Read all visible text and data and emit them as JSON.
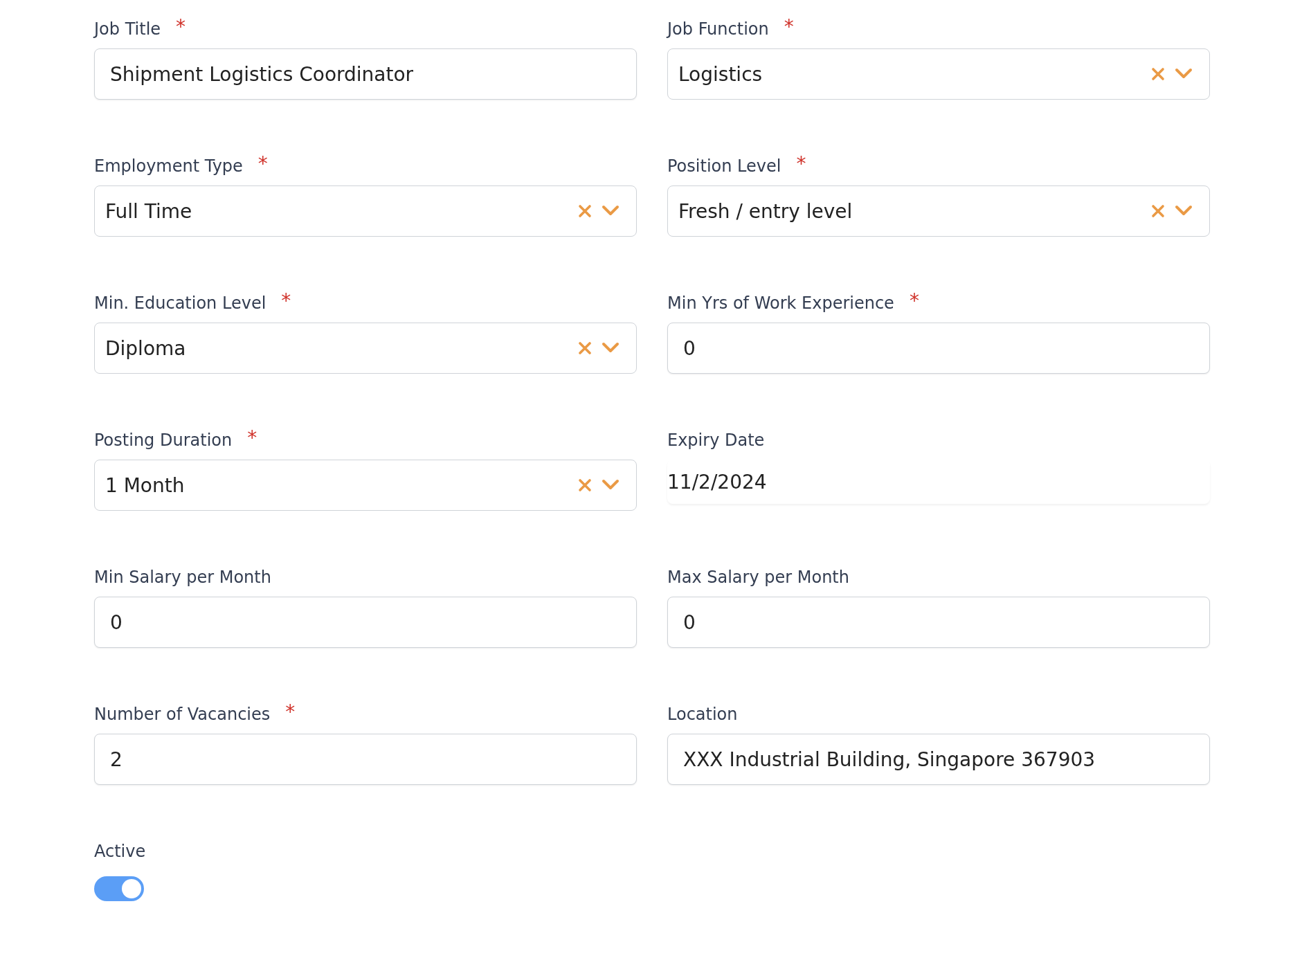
{
  "fields": [
    {
      "label": "Job Title",
      "required": true,
      "kind": "text",
      "value": "Shipment Logistics Coordinator"
    },
    {
      "label": "Job Function",
      "required": true,
      "kind": "select",
      "value": "Logistics"
    },
    {
      "label": "Employment Type",
      "required": true,
      "kind": "select",
      "value": "Full Time"
    },
    {
      "label": "Position Level",
      "required": true,
      "kind": "select",
      "value": "Fresh / entry level"
    },
    {
      "label": "Min. Education Level",
      "required": true,
      "kind": "select",
      "value": "Diploma"
    },
    {
      "label": "Min Yrs of Work Experience",
      "required": true,
      "kind": "text",
      "value": "0"
    },
    {
      "label": "Posting Duration",
      "required": true,
      "kind": "select",
      "value": "1 Month"
    },
    {
      "label": "Expiry Date",
      "required": false,
      "kind": "date",
      "value": "11/2/2024"
    },
    {
      "label": "Min Salary per Month",
      "required": false,
      "kind": "text",
      "value": "0"
    },
    {
      "label": "Max Salary per Month",
      "required": false,
      "kind": "text",
      "value": "0"
    },
    {
      "label": "Number of Vacancies",
      "required": true,
      "kind": "text",
      "value": "2"
    },
    {
      "label": "Location",
      "required": false,
      "kind": "text",
      "value": "XXX Industrial Building, Singapore 367903"
    }
  ],
  "required_mark": "*",
  "active": {
    "label": "Active",
    "on": true
  }
}
